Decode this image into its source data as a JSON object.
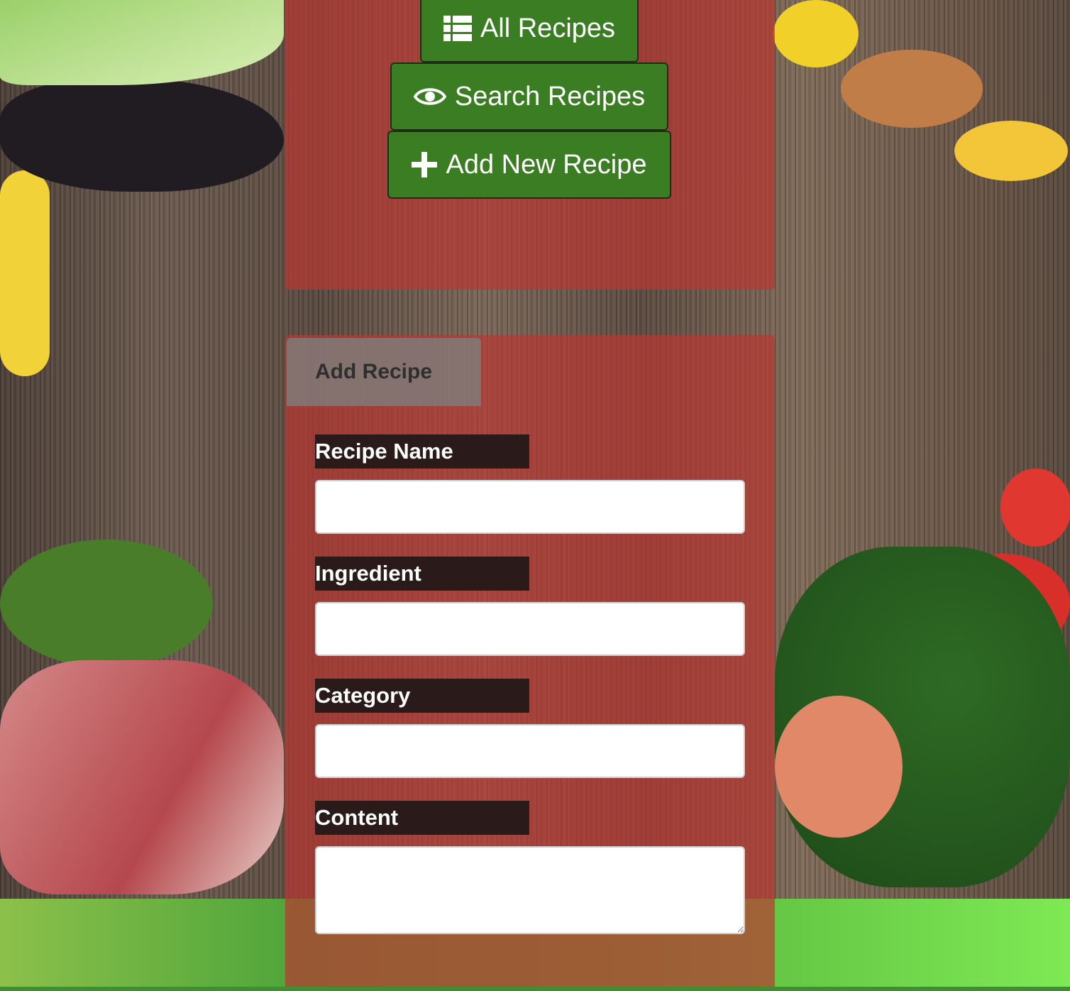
{
  "nav": {
    "all_recipes": "All Recipes",
    "search_recipes": "Search Recipes",
    "add_new_recipe": "Add New Recipe"
  },
  "form": {
    "tab_label": "Add Recipe",
    "fields": [
      {
        "label": "Recipe Name",
        "value": ""
      },
      {
        "label": "Ingredient",
        "value": ""
      },
      {
        "label": "Category",
        "value": ""
      },
      {
        "label": "Content",
        "value": ""
      }
    ]
  },
  "colors": {
    "button_green": "#3a7d22",
    "panel_red": "#b93732",
    "footer_green": "#5ab83e"
  }
}
